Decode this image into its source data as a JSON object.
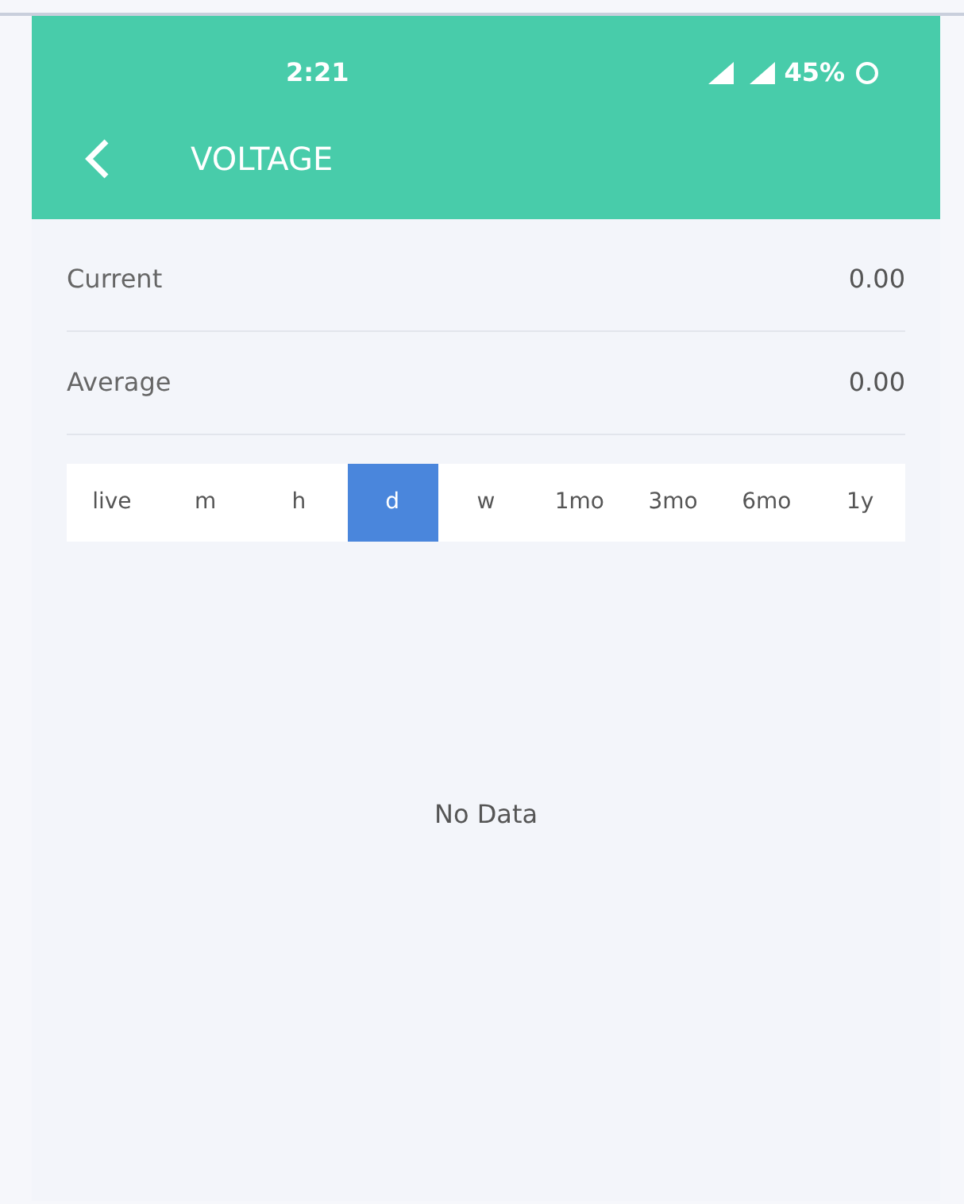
{
  "status_bar": {
    "time": "2:21",
    "battery": "45%"
  },
  "header": {
    "title": "VOLTAGE"
  },
  "stats": [
    {
      "label": "Current",
      "value": "0.00"
    },
    {
      "label": "Average",
      "value": "0.00"
    }
  ],
  "ranges": [
    {
      "label": "live",
      "selected": false
    },
    {
      "label": "m",
      "selected": false
    },
    {
      "label": "h",
      "selected": false
    },
    {
      "label": "d",
      "selected": true
    },
    {
      "label": "w",
      "selected": false
    },
    {
      "label": "1mo",
      "selected": false
    },
    {
      "label": "3mo",
      "selected": false
    },
    {
      "label": "6mo",
      "selected": false
    },
    {
      "label": "1y",
      "selected": false
    }
  ],
  "chart": {
    "empty_message": "No Data"
  }
}
